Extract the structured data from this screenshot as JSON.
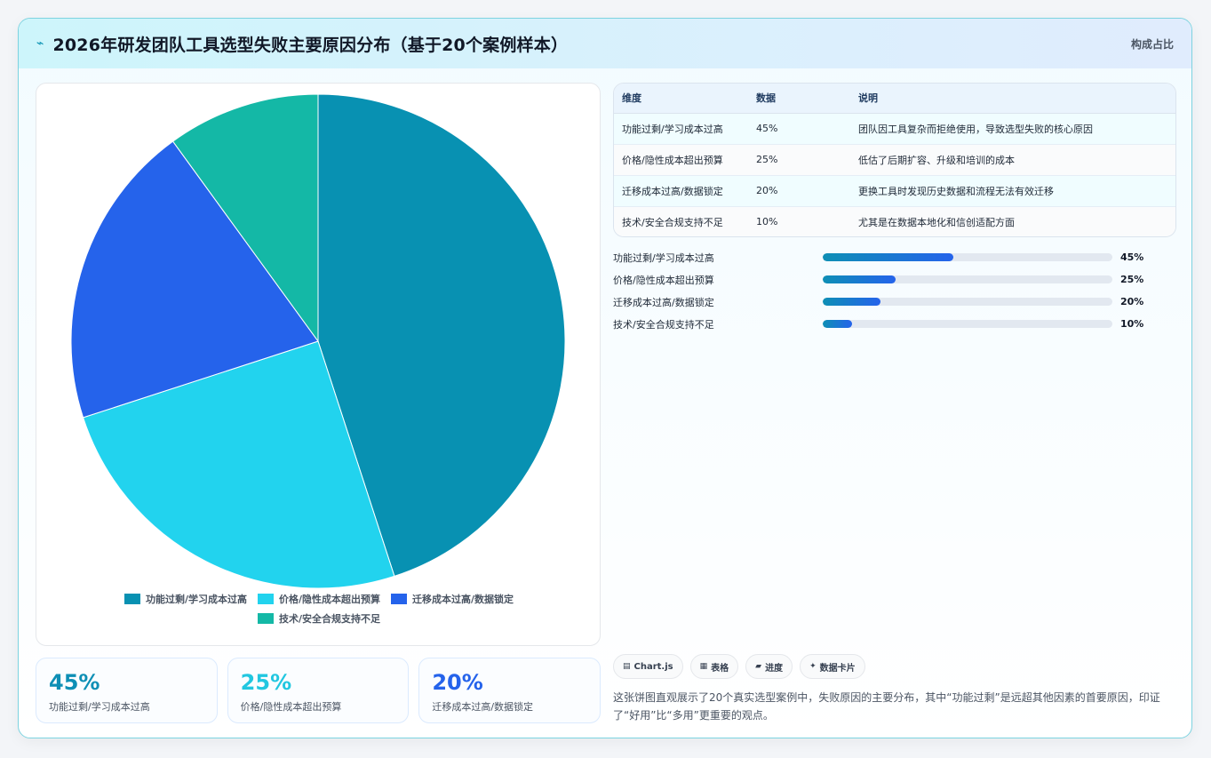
{
  "header": {
    "title": "2026年研发团队工具选型失败主要原因分布（基于20个案例样本）",
    "tag": "构成占比",
    "icon": "lightning-icon"
  },
  "colors": {
    "slice1": "#0891b2",
    "slice2": "#22d3ee",
    "slice3": "#2563eb",
    "slice4": "#14b8a6",
    "stat1": "#0e8fb5",
    "stat2": "#22c7e0",
    "stat3": "#2563eb"
  },
  "chart_data": {
    "type": "pie",
    "categories": [
      "功能过剩/学习成本过高",
      "价格/隐性成本超出预算",
      "迁移成本过高/数据锁定",
      "技术/安全合规支持不足"
    ],
    "values": [
      45,
      25,
      20,
      10
    ],
    "colors": [
      "#0891b2",
      "#22d3ee",
      "#2563eb",
      "#14b8a6"
    ],
    "legend": "bottom"
  },
  "table": {
    "headers": [
      "维度",
      "数据",
      "说明"
    ],
    "rows": [
      [
        "功能过剩/学习成本过高",
        "45%",
        "团队因工具复杂而拒绝使用，导致选型失败的核心原因"
      ],
      [
        "价格/隐性成本超出预算",
        "25%",
        "低估了后期扩容、升级和培训的成本"
      ],
      [
        "迁移成本过高/数据锁定",
        "20%",
        "更换工具时发现历史数据和流程无法有效迁移"
      ],
      [
        "技术/安全合规支持不足",
        "10%",
        "尤其是在数据本地化和信创适配方面"
      ]
    ]
  },
  "progress": [
    {
      "label": "功能过剩/学习成本过高",
      "value": 45,
      "display": "45%"
    },
    {
      "label": "价格/隐性成本超出预算",
      "value": 25,
      "display": "25%"
    },
    {
      "label": "迁移成本过高/数据锁定",
      "value": 20,
      "display": "20%"
    },
    {
      "label": "技术/安全合规支持不足",
      "value": 10,
      "display": "10%"
    }
  ],
  "stats": [
    {
      "value": "45%",
      "label": "功能过剩/学习成本过高"
    },
    {
      "value": "25%",
      "label": "价格/隐性成本超出预算"
    },
    {
      "value": "20%",
      "label": "迁移成本过高/数据锁定"
    }
  ],
  "chips": [
    {
      "icon": "chart-icon",
      "glyph": "▤",
      "label": "Chart.js"
    },
    {
      "icon": "table-icon",
      "glyph": "▦",
      "label": "表格"
    },
    {
      "icon": "progress-icon",
      "glyph": "▰",
      "label": "进度"
    },
    {
      "icon": "sparkle-icon",
      "glyph": "✦",
      "label": "数据卡片"
    }
  ],
  "note": "这张饼图直观展示了20个真实选型案例中，失败原因的主要分布，其中“功能过剩”是远超其他因素的首要原因，印证了“好用”比“多用”更重要的观点。"
}
